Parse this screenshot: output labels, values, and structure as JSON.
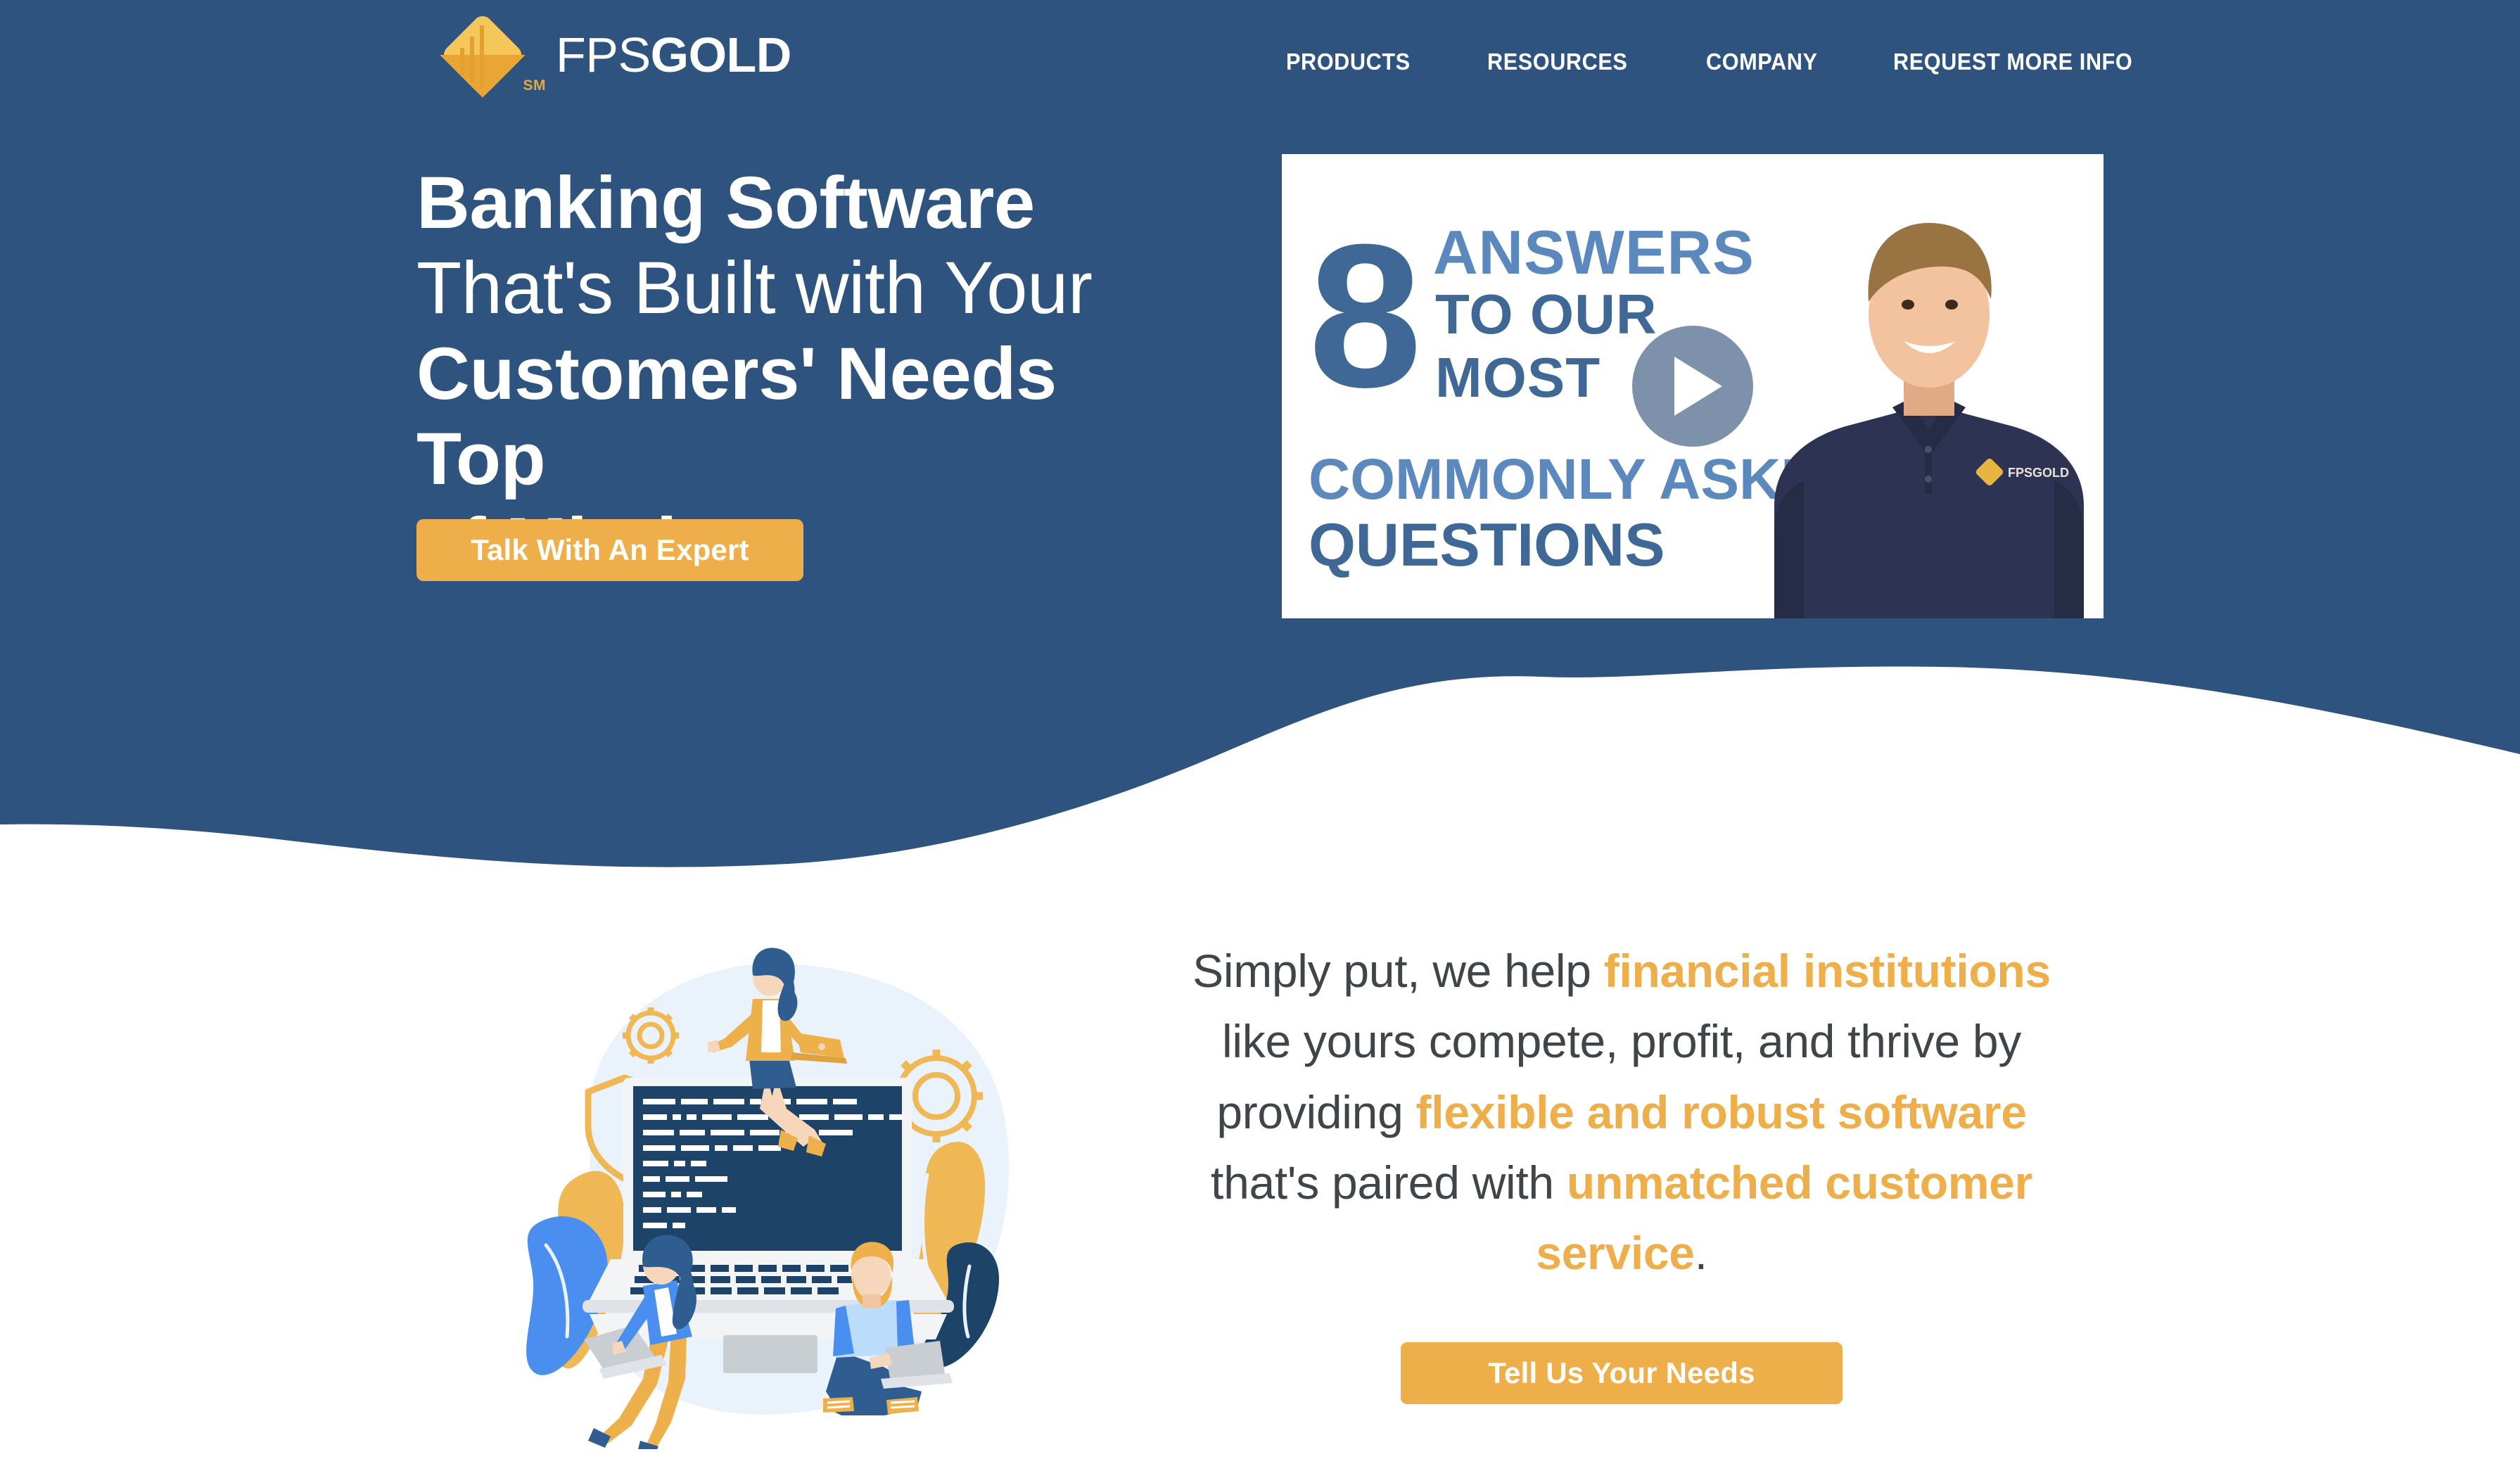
{
  "brand": {
    "name_light": "FPS",
    "name_bold": "GOLD",
    "service_mark": "SM",
    "logo_icon": "fpsgold-diamond-logo"
  },
  "nav": {
    "items": [
      {
        "label": "PRODUCTS"
      },
      {
        "label": "RESOURCES"
      },
      {
        "label": "COMPANY"
      },
      {
        "label": "REQUEST MORE INFO"
      }
    ]
  },
  "hero": {
    "headline": {
      "line1": "Banking Software",
      "line2": "That's Built with Your",
      "line3": "Customers' Needs Top",
      "line4": "of Mind"
    },
    "cta_label": "Talk With An Expert",
    "video": {
      "title_number": "8",
      "title_line1": "ANSWERS",
      "title_line2": "TO OUR",
      "title_line3": "MOST",
      "title_line4": "COMMONLY ASKED",
      "title_line5": "QUESTIONS",
      "play_icon": "play-icon",
      "presenter_shirt_logo": "FPSGOLD"
    }
  },
  "intro": {
    "text_1": "Simply put, we help ",
    "highlight_1": "financial institutions",
    "text_2": " like yours compete, profit, and thrive by providing ",
    "highlight_2": "flexible and robust software",
    "text_3": " that's paired with ",
    "highlight_3": "unmatched customer service",
    "text_4": ".",
    "cta_label": "Tell Us Your Needs",
    "illustration_icons": [
      "gear-icon",
      "shield-icon",
      "laptop-icon",
      "person-icon"
    ]
  },
  "colors": {
    "hero_blue": "#2d537e",
    "gold": "#eeaf4a",
    "gold_dark": "#e8a838",
    "text_dark": "#3f4548",
    "screen_navy": "#1d4468",
    "blob_pale_blue": "#eaf2fb",
    "play_button": "#5e7696"
  }
}
